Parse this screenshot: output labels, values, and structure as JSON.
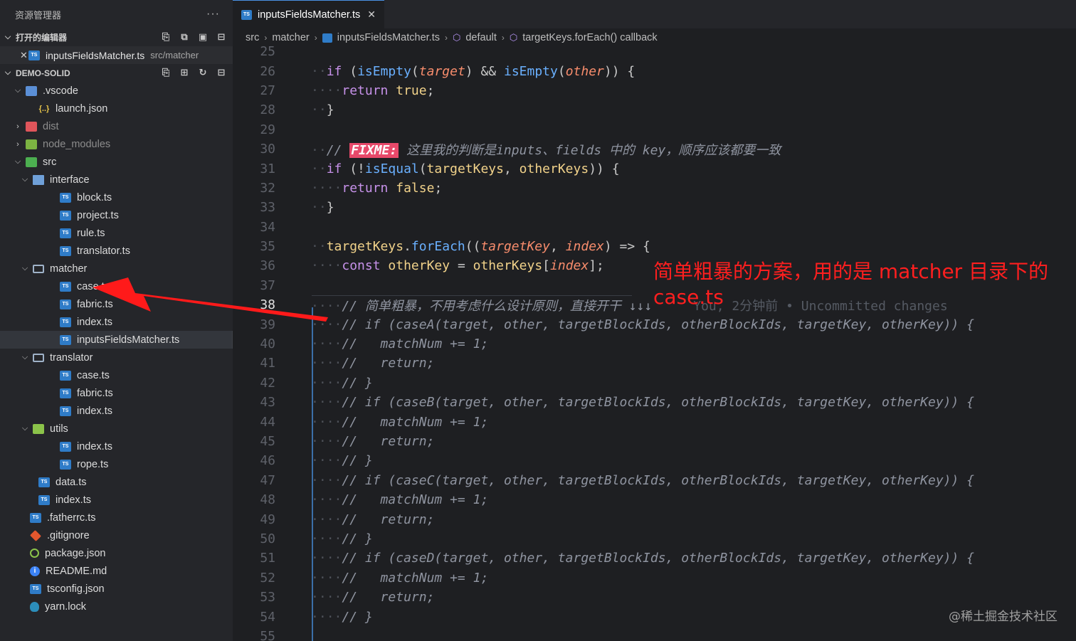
{
  "sidebar": {
    "title": "资源管理器",
    "more": "···",
    "open_editors": {
      "label": "打开的编辑器",
      "file": "inputsFieldsMatcher.ts",
      "path": "src/matcher",
      "close": "✕"
    },
    "project": {
      "label": "DEMO-SOLID"
    },
    "tree": [
      {
        "label": ".vscode",
        "depth": 1,
        "twist": "⌵",
        "icon": "vscode-folder-icon"
      },
      {
        "label": "launch.json",
        "depth": 2,
        "twist": "",
        "icon": "json-icon"
      },
      {
        "label": "dist",
        "depth": 1,
        "twist": "›",
        "icon": "dist-folder-icon",
        "dim": true
      },
      {
        "label": "node_modules",
        "depth": 1,
        "twist": "›",
        "icon": "node-modules-folder-icon",
        "dim": true
      },
      {
        "label": "src",
        "depth": 1,
        "twist": "⌵",
        "icon": "src-folder-icon"
      },
      {
        "label": "interface",
        "depth": 2,
        "twist": "⌵",
        "icon": "interface-folder-icon"
      },
      {
        "label": "block.ts",
        "depth": 3,
        "twist": "",
        "icon": "ts-file-icon"
      },
      {
        "label": "project.ts",
        "depth": 3,
        "twist": "",
        "icon": "ts-file-icon"
      },
      {
        "label": "rule.ts",
        "depth": 3,
        "twist": "",
        "icon": "ts-file-icon"
      },
      {
        "label": "translator.ts",
        "depth": 3,
        "twist": "",
        "icon": "ts-file-icon"
      },
      {
        "label": "matcher",
        "depth": 2,
        "twist": "⌵",
        "icon": "folder-open-icon"
      },
      {
        "label": "case.ts",
        "depth": 3,
        "twist": "",
        "icon": "ts-file-icon"
      },
      {
        "label": "fabric.ts",
        "depth": 3,
        "twist": "",
        "icon": "ts-file-icon"
      },
      {
        "label": "index.ts",
        "depth": 3,
        "twist": "",
        "icon": "ts-file-icon"
      },
      {
        "label": "inputsFieldsMatcher.ts",
        "depth": 3,
        "twist": "",
        "icon": "ts-file-icon",
        "selected": true
      },
      {
        "label": "translator",
        "depth": 2,
        "twist": "⌵",
        "icon": "folder-open-icon"
      },
      {
        "label": "case.ts",
        "depth": 3,
        "twist": "",
        "icon": "ts-file-icon"
      },
      {
        "label": "fabric.ts",
        "depth": 3,
        "twist": "",
        "icon": "ts-file-icon"
      },
      {
        "label": "index.ts",
        "depth": 3,
        "twist": "",
        "icon": "ts-file-icon"
      },
      {
        "label": "utils",
        "depth": 2,
        "twist": "⌵",
        "icon": "utils-folder-icon"
      },
      {
        "label": "index.ts",
        "depth": 3,
        "twist": "",
        "icon": "ts-file-icon"
      },
      {
        "label": "rope.ts",
        "depth": 3,
        "twist": "",
        "icon": "ts-file-icon"
      },
      {
        "label": "data.ts",
        "depth": 2,
        "twist": "",
        "icon": "ts-file-icon"
      },
      {
        "label": "index.ts",
        "depth": 2,
        "twist": "",
        "icon": "ts-file-icon"
      },
      {
        "label": ".fatherrc.ts",
        "depth": 1,
        "twist": "",
        "icon": "ts-file-icon"
      },
      {
        "label": ".gitignore",
        "depth": 1,
        "twist": "",
        "icon": "git-icon"
      },
      {
        "label": "package.json",
        "depth": 1,
        "twist": "",
        "icon": "package-icon"
      },
      {
        "label": "README.md",
        "depth": 1,
        "twist": "",
        "icon": "info-icon"
      },
      {
        "label": "tsconfig.json",
        "depth": 1,
        "twist": "",
        "icon": "tsconfig-icon"
      },
      {
        "label": "yarn.lock",
        "depth": 1,
        "twist": "",
        "icon": "yarn-icon"
      }
    ]
  },
  "tab": {
    "label": "inputsFieldsMatcher.ts",
    "close": "✕"
  },
  "breadcrumb": [
    "src",
    "matcher",
    "inputsFieldsMatcher.ts",
    "default",
    "targetKeys.forEach() callback"
  ],
  "code": {
    "current_line": 38,
    "lines": [
      {
        "n": "25",
        "t": ""
      },
      {
        "n": "26",
        "t": "if (isEmpty(target) && isEmpty(other)) {"
      },
      {
        "n": "27",
        "t": "return true;"
      },
      {
        "n": "28",
        "t": "}"
      },
      {
        "n": "29",
        "t": ""
      },
      {
        "n": "30",
        "t": "// FIXME: 这里我的判断是inputs、fields 中的 key，顺序应该都要一致"
      },
      {
        "n": "31",
        "t": "if (!isEqual(targetKeys, otherKeys)) {"
      },
      {
        "n": "32",
        "t": "return false;"
      },
      {
        "n": "33",
        "t": "}"
      },
      {
        "n": "34",
        "t": ""
      },
      {
        "n": "35",
        "t": "targetKeys.forEach((targetKey, index) => {"
      },
      {
        "n": "36",
        "t": "const otherKey = otherKeys[index];"
      },
      {
        "n": "37",
        "t": ""
      },
      {
        "n": "38",
        "t": "// 简单粗暴，不用考虑什么设计原则，直接开干 ↓↓↓"
      },
      {
        "n": "39",
        "t": "// if (caseA(target, other, targetBlockIds, otherBlockIds, targetKey, otherKey)) {"
      },
      {
        "n": "40",
        "t": "//   matchNum += 1;"
      },
      {
        "n": "41",
        "t": "//   return;"
      },
      {
        "n": "42",
        "t": "// }"
      },
      {
        "n": "43",
        "t": "// if (caseB(target, other, targetBlockIds, otherBlockIds, targetKey, otherKey)) {"
      },
      {
        "n": "44",
        "t": "//   matchNum += 1;"
      },
      {
        "n": "45",
        "t": "//   return;"
      },
      {
        "n": "46",
        "t": "// }"
      },
      {
        "n": "47",
        "t": "// if (caseC(target, other, targetBlockIds, otherBlockIds, targetKey, otherKey)) {"
      },
      {
        "n": "48",
        "t": "//   matchNum += 1;"
      },
      {
        "n": "49",
        "t": "//   return;"
      },
      {
        "n": "50",
        "t": "// }"
      },
      {
        "n": "51",
        "t": "// if (caseD(target, other, targetBlockIds, otherBlockIds, targetKey, otherKey)) {"
      },
      {
        "n": "52",
        "t": "//   matchNum += 1;"
      },
      {
        "n": "53",
        "t": "//   return;"
      },
      {
        "n": "54",
        "t": "// }"
      },
      {
        "n": "55",
        "t": ""
      }
    ],
    "blame": "You, 2分钟前 • Uncommitted changes"
  },
  "annotation": "简单粗暴的方案，用的是 matcher 目录下的 case.ts",
  "watermark": "@稀土掘金技术社区",
  "colors": {
    "accent": "#4a90e2",
    "annotation": "#ff1f1f",
    "fixme_bg": "#e8496a"
  }
}
